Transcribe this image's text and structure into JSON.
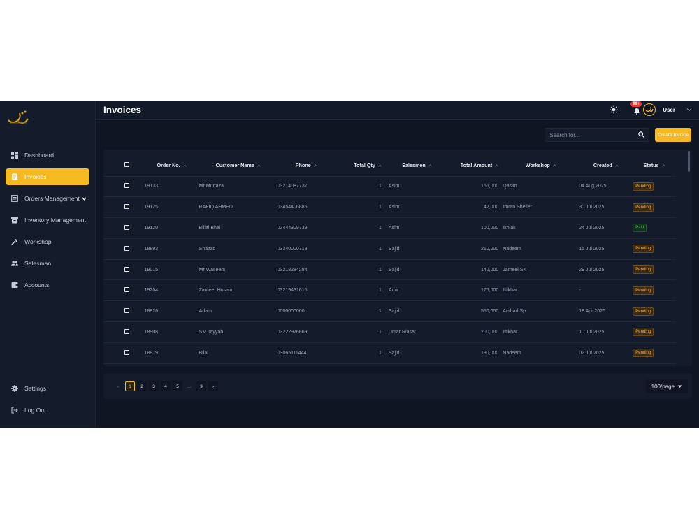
{
  "app": {
    "brand_colors": {
      "accent": "#f5b921",
      "background": "#0f1523",
      "panel": "#141b2b"
    }
  },
  "sidebar": {
    "items": [
      {
        "label": "Dashboard",
        "icon": "dashboard-icon"
      },
      {
        "label": "Invoices",
        "icon": "invoice-icon",
        "active": true
      },
      {
        "label": "Orders Management",
        "icon": "orders-icon",
        "has_chevron": true
      },
      {
        "label": "Inventory Management",
        "icon": "inventory-icon"
      },
      {
        "label": "Workshop",
        "icon": "workshop-icon"
      },
      {
        "label": "Salesman",
        "icon": "salesman-icon"
      },
      {
        "label": "Accounts",
        "icon": "accounts-icon"
      }
    ],
    "bottom_items": [
      {
        "label": "Settings",
        "icon": "gear-icon"
      },
      {
        "label": "Log Out",
        "icon": "logout-icon"
      }
    ]
  },
  "header": {
    "title": "Invoices",
    "notification_count": "99+",
    "user_name": "User"
  },
  "toolbar": {
    "search_placeholder": "Search for...",
    "create_label": "Create Invoice"
  },
  "table": {
    "columns": [
      "Order No.",
      "Customer Name",
      "Phone",
      "Total Qty",
      "Salesmen",
      "Total Amount",
      "Workshop",
      "Created",
      "Status"
    ],
    "rows": [
      {
        "order": "19133",
        "customer": "Mr Murtaza",
        "phone": "03214087737",
        "qty": "1",
        "salesman": "Asim",
        "amount": "165,000",
        "workshop": "Qasim",
        "created": "04 Aug 2025",
        "status": "Pending"
      },
      {
        "order": "19125",
        "customer": "RAFIQ AHMED",
        "phone": "03454406885",
        "qty": "1",
        "salesman": "Asim",
        "amount": "42,000",
        "workshop": "Imran Sheller",
        "created": "30 Jul 2025",
        "status": "Pending"
      },
      {
        "order": "19120",
        "customer": "Billal Bhai",
        "phone": "03444309739",
        "qty": "1",
        "salesman": "Asim",
        "amount": "100,000",
        "workshop": "Ikhlak",
        "created": "24 Jul 2025",
        "status": "Paid"
      },
      {
        "order": "18893",
        "customer": "Shazad",
        "phone": "03340000718",
        "qty": "1",
        "salesman": "Sajid",
        "amount": "210,000",
        "workshop": "Nadeem",
        "created": "15 Jul 2025",
        "status": "Pending"
      },
      {
        "order": "19015",
        "customer": "Mr Waseem",
        "phone": "03218284284",
        "qty": "1",
        "salesman": "Sajid",
        "amount": "140,000",
        "workshop": "Jameel SK",
        "created": "29 Jul 2025",
        "status": "Pending"
      },
      {
        "order": "19204",
        "customer": "Zameer Husain",
        "phone": "03219431615",
        "qty": "1",
        "salesman": "Amir",
        "amount": "175,000",
        "workshop": "Iftikhar",
        "created": "-",
        "status": "Pending"
      },
      {
        "order": "18826",
        "customer": "Adam",
        "phone": "0000000000",
        "qty": "1",
        "salesman": "Sajid",
        "amount": "550,000",
        "workshop": "Arshad Sp",
        "created": "18 Apr 2025",
        "status": "Pending"
      },
      {
        "order": "18908",
        "customer": "SM Tayyab",
        "phone": "03222976869",
        "qty": "1",
        "salesman": "Umar Riasat",
        "amount": "200,000",
        "workshop": "Iftikhar",
        "created": "10 Jul 2025",
        "status": "Pending"
      },
      {
        "order": "18879",
        "customer": "Bilal",
        "phone": "03065111444",
        "qty": "1",
        "salesman": "Sajid",
        "amount": "190,000",
        "workshop": "Nadeem",
        "created": "02 Jul 2025",
        "status": "Pending"
      }
    ]
  },
  "pagination": {
    "prev": "‹",
    "pages": [
      "1",
      "2",
      "3",
      "4",
      "5",
      "...",
      "9"
    ],
    "current": "1",
    "next": "›",
    "per_page": "100/page"
  }
}
